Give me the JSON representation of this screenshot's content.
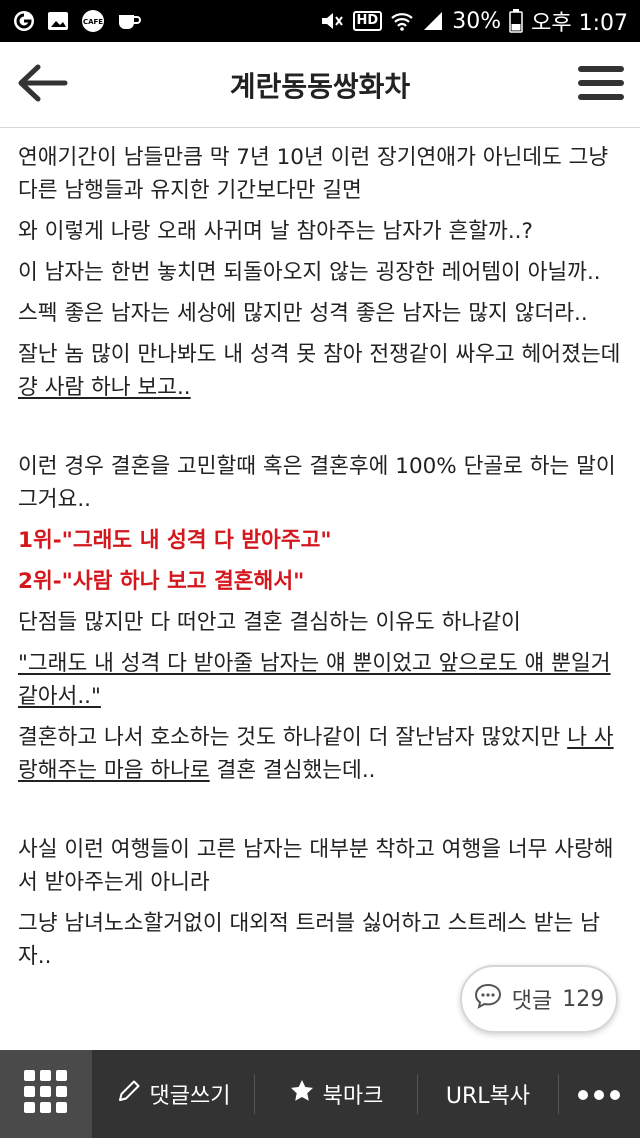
{
  "status_bar": {
    "battery": "30%",
    "time": "오후 1:07",
    "hd": "HD"
  },
  "header": {
    "title": "계란동동쌍화차"
  },
  "post": {
    "p1": "연애기간이 남들만큼 막 7년 10년 이런 장기연애가 아닌데도 그냥 다른 남행들과 유지한 기간보다만 길면",
    "p2": "와 이렇게 나랑 오래 사귀며 날 참아주는 남자가 흔할까..?",
    "p3": "이 남자는 한번 놓치면 되돌아오지 않는 굉장한 레어템이 아닐까..",
    "p4": "스펙 좋은 남자는 세상에 많지만 성격 좋은 남자는 많지 않더라..",
    "p5_a": "잘난 놈 많이 만나봐도 내 성격 못 참아 전쟁같이 싸우고 헤어졌는데 ",
    "p5_b": "걍 사람 하나 보고..",
    "p6": "이런 경우 결혼을 고민할때 혹은 결혼후에 100% 단골로 하는 말이 그거요..",
    "p7": "1위-\"그래도 내 성격 다 받아주고\"",
    "p8": "2위-\"사람 하나 보고 결혼해서\"",
    "p9": "단점들 많지만 다 떠안고 결혼 결심하는 이유도 하나같이",
    "p10": "\"그래도 내 성격 다 받아줄 남자는 얘 뿐이었고 앞으로도 얘 뿐일거같아서..\"",
    "p11_a": "결혼하고 나서 호소하는 것도 하나같이 더 잘난남자 많았지만 ",
    "p11_b": "나 사랑해주는 마음 하나로",
    "p11_c": " 결혼 결심했는데..",
    "p12": "사실 이런 여행들이 고른 남자는 대부분 착하고 여행을 너무 사랑해서 받아주는게 아니라",
    "p13": "그냥 남녀노소할거없이 대외적 트러블 싫어하고 스트레스 받는 남자.."
  },
  "comment_float": {
    "label": "댓글",
    "count": "129"
  },
  "bottom_bar": {
    "write_comment": "댓글쓰기",
    "bookmark": "북마크",
    "copy_url": "URL복사"
  },
  "icons": {
    "back": "back-arrow-icon",
    "menu": "hamburger-menu-icon",
    "grid": "grid-icon",
    "pencil": "pencil-icon",
    "star": "star-icon",
    "more": "more-dots-icon",
    "comment": "comment-bubble-icon"
  },
  "colors": {
    "highlight": "#d4161d",
    "bottom_bar": "#333333",
    "status_bar": "#000000"
  }
}
